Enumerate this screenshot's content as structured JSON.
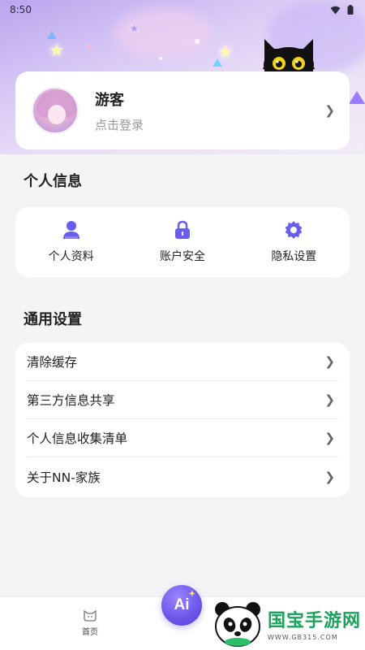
{
  "status_bar": {
    "time": "8:50"
  },
  "profile": {
    "name": "游客",
    "subtitle": "点击登录"
  },
  "personal_info": {
    "title": "个人信息",
    "items": [
      {
        "label": "个人资料",
        "icon": "user-icon"
      },
      {
        "label": "账户安全",
        "icon": "lock-icon"
      },
      {
        "label": "隐私设置",
        "icon": "gear-icon"
      }
    ]
  },
  "general_settings": {
    "title": "通用设置",
    "rows": [
      {
        "label": "清除缓存"
      },
      {
        "label": "第三方信息共享"
      },
      {
        "label": "个人信息收集清单"
      },
      {
        "label": "关于NN-家族"
      }
    ]
  },
  "tabbar": {
    "home_label": "首页",
    "ai_label": "Ai"
  },
  "watermark": {
    "title": "国宝手游网",
    "url": "WWW.GB315.COM"
  },
  "colors": {
    "accent": "#6a55e8",
    "icon": "#6b5cf0",
    "watermark": "#1aa35a"
  }
}
